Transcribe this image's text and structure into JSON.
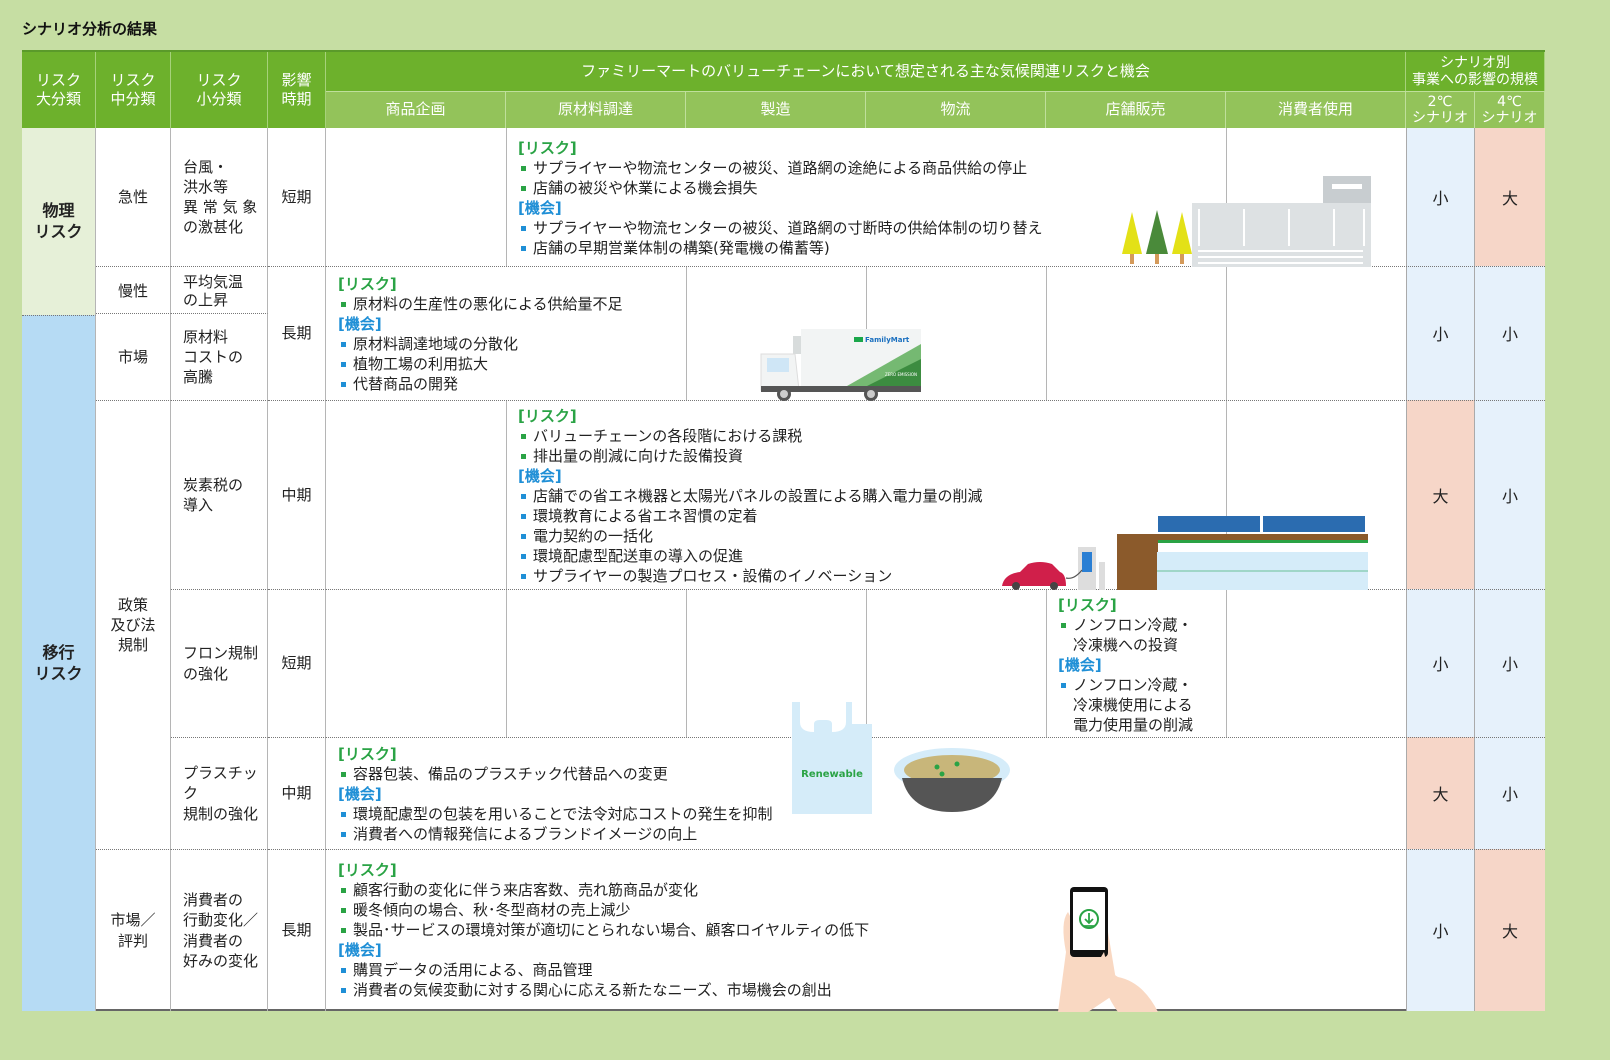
{
  "title": "シナリオ分析の結果",
  "header": {
    "col_major": "リスク\n大分類",
    "col_middle": "リスク\n中分類",
    "col_minor": "リスク\n小分類",
    "col_period": "影響\n時期",
    "value_chain_title": "ファミリーマートのバリューチェーンにおいて想定される主な気候関連リスクと機会",
    "value_chain_stages": [
      "商品企画",
      "原材料調達",
      "製造",
      "物流",
      "店舗販売",
      "消費者使用"
    ],
    "scenario_title": "シナリオ別\n事業への影響の規模",
    "scenario_2c": "2℃\nシナリオ",
    "scenario_4c": "4℃\nシナリオ"
  },
  "labels": {
    "risk": "[リスク]",
    "opportunity": "[機会]"
  },
  "colors": {
    "header_green": "#6db12c",
    "subheader_green": "#93c35a",
    "risk_green": "#2aa345",
    "opportunity_blue": "#1f8fd6",
    "small_bg": "#e6f1fb",
    "large_bg": "#f6d6c8",
    "physical_bg": "#e6f0d8",
    "transition_bg": "#b6dbf4"
  },
  "major_categories": [
    {
      "label": "物理\nリスク"
    },
    {
      "label": "移行\nリスク"
    }
  ],
  "rows": [
    {
      "middle": "急性",
      "minor": "台風・\n洪水等\n異 常 気 象\nの激甚化",
      "period": "短期",
      "risks": [
        "サプライヤーや物流センターの被災、道路網の途絶による商品供給の停止",
        "店舗の被災や休業による機会損失"
      ],
      "opportunities": [
        "サプライヤーや物流センターの被災、道路網の寸断時の供給体制の切り替え",
        "店舗の早期営業体制の構築(発電機の備蓄等)"
      ],
      "impact_2c": "小",
      "impact_4c": "大",
      "illustration": "distribution-center-with-trees"
    },
    {
      "middle": "慢性",
      "minor": "平均気温\nの上昇",
      "period": "長期",
      "risks": [
        "原材料の生産性の悪化による供給量不足"
      ],
      "opportunities": [
        "原材料調達地域の分散化",
        "植物工場の利用拡大",
        "代替商品の開発"
      ],
      "impact_2c": "小",
      "impact_4c": "小",
      "illustration": "familymart-delivery-truck"
    },
    {
      "middle": "市場",
      "minor": "原材料\nコストの\n高騰"
    },
    {
      "middle": "政策\n及び法\n規制",
      "minor": "炭素税の\n導入",
      "period": "中期",
      "risks": [
        "バリューチェーンの各段階における課税",
        "排出量の削減に向けた設備投資"
      ],
      "opportunities": [
        "店舗での省エネ機器と太陽光パネルの設置による購入電力量の削減",
        "環境教育による省エネ習慣の定着",
        "電力契約の一括化",
        "環境配慮型配送車の導入の促進",
        "サプライヤーの製造プロセス・設備のイノベーション"
      ],
      "impact_2c": "大",
      "impact_4c": "小",
      "illustration": "store-with-solar-panels-and-ev"
    },
    {
      "minor": "フロン規制\nの強化",
      "period": "短期",
      "risks": [
        "ノンフロン冷蔵・\n冷凍機への投資"
      ],
      "opportunities": [
        "ノンフロン冷蔵・\n冷凍機使用による\n電力使用量の削減"
      ],
      "impact_2c": "小",
      "impact_4c": "小"
    },
    {
      "minor": "プラスチック\n規制の強化",
      "period": "中期",
      "risks": [
        "容器包装、備品のプラスチック代替品への変更"
      ],
      "opportunities": [
        "環境配慮型の包装を用いることで法令対応コストの発生を抑制",
        "消費者への情報発信によるブランドイメージの向上"
      ],
      "impact_2c": "大",
      "impact_4c": "小",
      "illustration": "renewable-bag-and-bowl",
      "bag_text": "Renewable"
    },
    {
      "middle": "市場／\n評判",
      "minor": "消費者の\n行動変化／\n消費者の\n好みの変化",
      "period": "長期",
      "risks": [
        "顧客行動の変化に伴う来店客数、売れ筋商品が変化",
        "暖冬傾向の場合、秋･冬型商材の売上減少",
        "製品･サービスの環境対策が適切にとられない場合、顧客ロイヤルティの低下"
      ],
      "opportunities": [
        "購買データの活用による、商品管理",
        "消費者の気候変動に対する関心に応える新たなニーズ、市場機会の創出"
      ],
      "impact_2c": "小",
      "impact_4c": "大",
      "illustration": "hand-holding-smartphone"
    }
  ],
  "truck_brand": "FamilyMart",
  "truck_slogan": "ZERO EMISSION"
}
